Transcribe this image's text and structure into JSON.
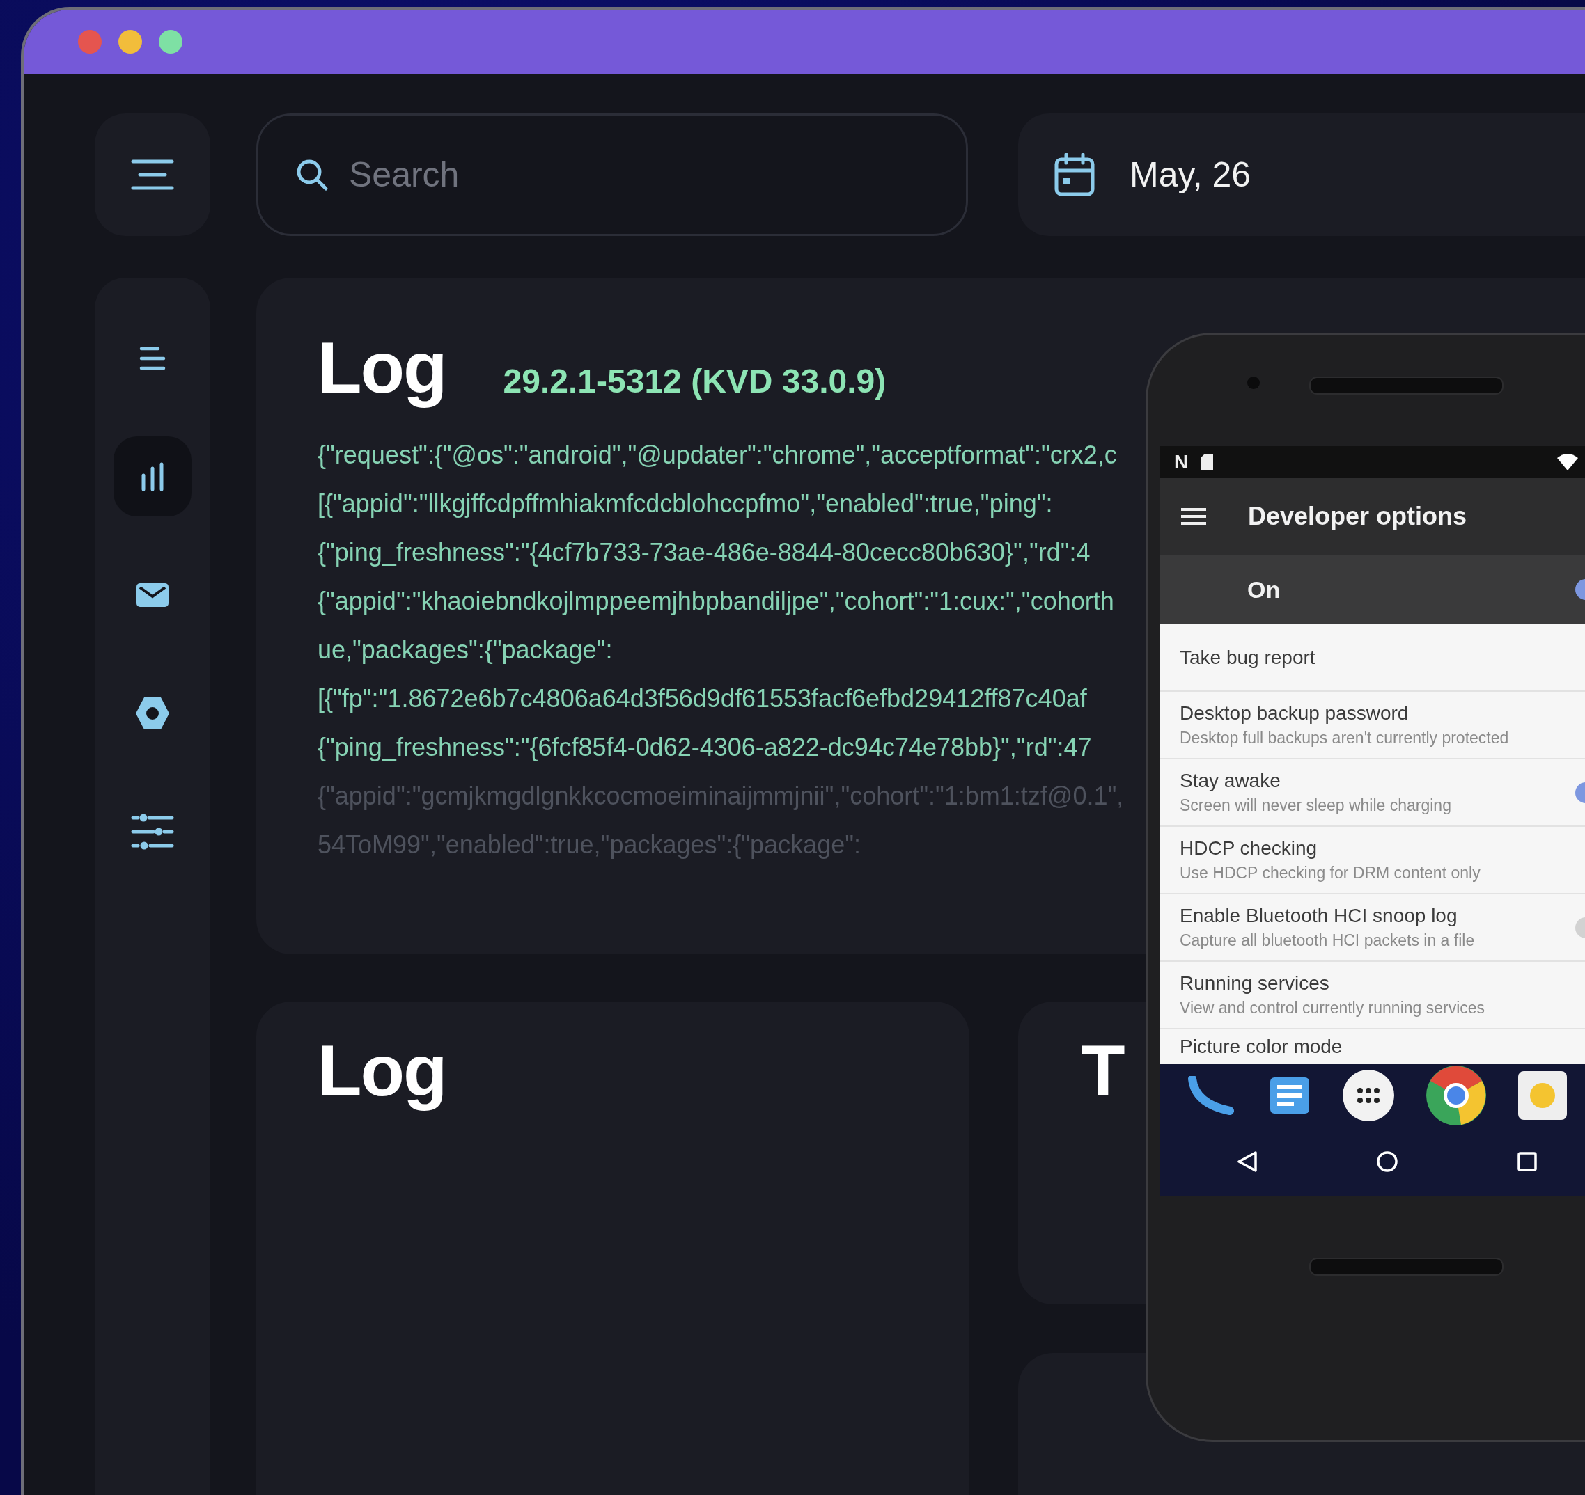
{
  "window": {
    "controls": [
      {
        "color": "#e5554f"
      },
      {
        "color": "#f2bd3b"
      },
      {
        "color": "#7ee0a4"
      }
    ]
  },
  "sidebar": {
    "items": [
      {
        "selected": false
      },
      {
        "selected": true
      },
      {
        "selected": false
      },
      {
        "selected": false
      },
      {
        "selected": false
      }
    ]
  },
  "search": {
    "placeholder": "Search"
  },
  "date": "May, 26",
  "log_card": {
    "title": "Log",
    "version": "29.2.1-5312 (KVD 33.0.9)",
    "lines": [
      {
        "text": "{\"request\":{\"@os\":\"android\",\"@updater\":\"chrome\",\"acceptformat\":\"crx2,c",
        "faded": false
      },
      {
        "text": "[{\"appid\":\"llkgjffcdpffmhiakmfcdcblohccpfmo\",\"enabled\":true,\"ping\":",
        "faded": false
      },
      {
        "text": "{\"ping_freshness\":\"{4cf7b733-73ae-486e-8844-80cecc80b630}\",\"rd\":4",
        "faded": false
      },
      {
        "text": "{\"appid\":\"khaoiebndkojlmppeemjhbpbandiljpe\",\"cohort\":\"1:cux:\",\"cohorth",
        "faded": false
      },
      {
        "text": "ue,\"packages\":{\"package\":",
        "faded": false
      },
      {
        "text": "[{\"fp\":\"1.8672e6b7c4806a64d3f56d9df61553facf6efbd29412ff87c40af",
        "faded": false
      },
      {
        "text": "{\"ping_freshness\":\"{6fcf85f4-0d62-4306-a822-dc94c74e78bb}\",\"rd\":47",
        "faded": false
      },
      {
        "text": "{\"appid\":\"gcmjkmgdlgnkkcocmoeiminaijmmjnii\",\"cohort\":\"1:bm1:tzf@0.1\",",
        "faded": true
      },
      {
        "text": "54ToM99\",\"enabled\":true,\"packages\":{\"package\":",
        "faded": true
      }
    ]
  },
  "cards": [
    {
      "title": "Log"
    },
    {
      "title": "T"
    }
  ],
  "phone": {
    "status_badge": "N",
    "title": "Developer options",
    "master": {
      "label": "On",
      "on": true
    },
    "settings": [
      {
        "kind": "plain",
        "title": "Take bug report"
      },
      {
        "kind": "plain",
        "title": "Desktop backup password",
        "subtitle": "Desktop full backups aren't currently protected"
      },
      {
        "kind": "toggle",
        "title": "Stay awake",
        "subtitle": "Screen will never sleep while charging",
        "on": true
      },
      {
        "kind": "plain",
        "title": "HDCP checking",
        "subtitle": "Use HDCP checking for DRM content only"
      },
      {
        "kind": "toggle",
        "title": "Enable Bluetooth HCI snoop log",
        "subtitle": "Capture all bluetooth HCI packets in a file",
        "on": false
      },
      {
        "kind": "plain",
        "title": "Running services",
        "subtitle": "View and control currently running services"
      },
      {
        "kind": "plain",
        "title": "Picture color mode"
      }
    ]
  }
}
